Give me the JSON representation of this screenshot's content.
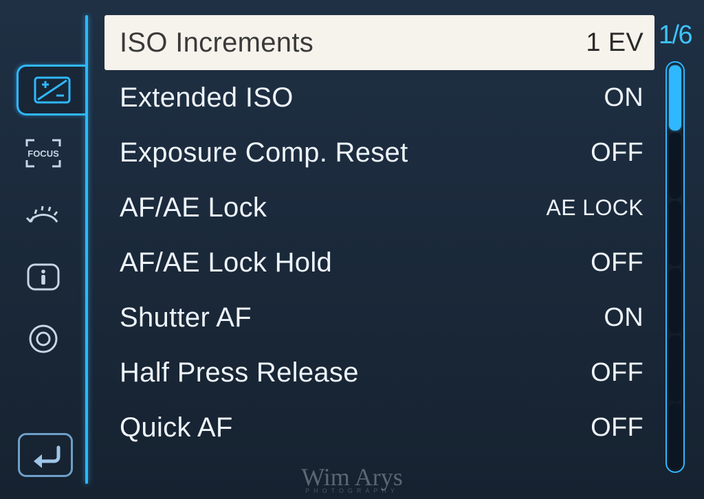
{
  "pager": {
    "label": "1/6",
    "segments": 6,
    "current": 1
  },
  "items": [
    {
      "label": "ISO Increments",
      "value": "1 EV",
      "selected": true
    },
    {
      "label": "Extended ISO",
      "value": "ON",
      "selected": false
    },
    {
      "label": "Exposure Comp. Reset",
      "value": "OFF",
      "selected": false
    },
    {
      "label": "AF/AE Lock",
      "value": "AE LOCK",
      "selected": false,
      "smallValue": true
    },
    {
      "label": "AF/AE Lock Hold",
      "value": "OFF",
      "selected": false
    },
    {
      "label": "Shutter AF",
      "value": "ON",
      "selected": false
    },
    {
      "label": "Half Press Release",
      "value": "OFF",
      "selected": false
    },
    {
      "label": "Quick AF",
      "value": "OFF",
      "selected": false
    }
  ],
  "tabs": [
    "exposure",
    "focus",
    "dial",
    "info",
    "lens"
  ],
  "watermark": {
    "main": "Wim Arys",
    "sub": "PHOTOGRAPHY"
  }
}
